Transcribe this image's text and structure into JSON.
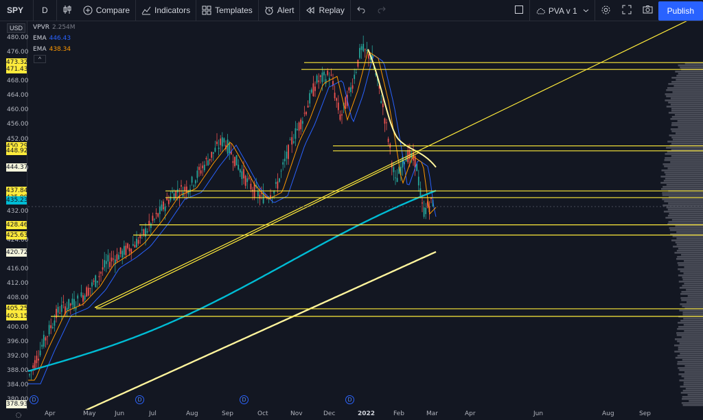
{
  "toolbar": {
    "symbol": "SPY",
    "interval": "D",
    "compare": "Compare",
    "indicators": "Indicators",
    "templates": "Templates",
    "alert": "Alert",
    "replay": "Replay",
    "layout": "PVA v 1",
    "publish": "Publish"
  },
  "currency": "USD",
  "legend": {
    "vpvr_name": "VPVR",
    "vpvr_value": "2.254M",
    "ema1_name": "EMA",
    "ema1_value": "446.43",
    "ema1_color": "#2962ff",
    "ema2_name": "EMA",
    "ema2_value": "438.34",
    "ema2_color": "#ff9800",
    "collapse": "^"
  },
  "price_ticks": [
    "480.00",
    "476.00",
    "468.00",
    "464.00",
    "460.00",
    "456.00",
    "452.00",
    "444.00",
    "432.00",
    "424.00",
    "416.00",
    "412.00",
    "408.00",
    "400.00",
    "396.00",
    "392.00",
    "388.00",
    "384.00",
    "380.00"
  ],
  "price_tags": [
    {
      "label": "473.32",
      "style": "yellow"
    },
    {
      "label": "471.43",
      "style": "yellow"
    },
    {
      "label": "450.29",
      "style": "yellow"
    },
    {
      "label": "448.92",
      "style": "yellow"
    },
    {
      "label": "444.37",
      "style": "white"
    },
    {
      "label": "437.84",
      "style": "yellow"
    },
    {
      "label": "435.99",
      "style": "yellow"
    },
    {
      "label": "435.23",
      "style": "cyan"
    },
    {
      "label": "428.46",
      "style": "yellow"
    },
    {
      "label": "425.63",
      "style": "yellow"
    },
    {
      "label": "420.72",
      "style": "white"
    },
    {
      "label": "405.25",
      "style": "yellow"
    },
    {
      "label": "403.15",
      "style": "yellow"
    },
    {
      "label": "378.93",
      "style": "white"
    }
  ],
  "time_labels": [
    {
      "label": "Apr",
      "bold": false
    },
    {
      "label": "May",
      "bold": false
    },
    {
      "label": "Jun",
      "bold": false
    },
    {
      "label": "Jul",
      "bold": false
    },
    {
      "label": "Aug",
      "bold": false
    },
    {
      "label": "Sep",
      "bold": false
    },
    {
      "label": "Oct",
      "bold": false
    },
    {
      "label": "Nov",
      "bold": false
    },
    {
      "label": "Dec",
      "bold": false
    },
    {
      "label": "2022",
      "bold": true
    },
    {
      "label": "Feb",
      "bold": false
    },
    {
      "label": "Mar",
      "bold": false
    },
    {
      "label": "Apr",
      "bold": false
    },
    {
      "label": "Jun",
      "bold": false
    },
    {
      "label": "Aug",
      "bold": false
    },
    {
      "label": "Sep",
      "bold": false
    }
  ],
  "dividend_marker": "D",
  "colors": {
    "up": "#26a69a",
    "down": "#ef5350",
    "level": "#ffeb3b",
    "sma200": "#fff59d",
    "ema_cyan": "#00bcd4",
    "bg": "#131722"
  },
  "chart_data": {
    "type": "candlestick",
    "symbol": "SPY",
    "interval": "D",
    "horizontal_levels": [
      473.32,
      471.43,
      450.29,
      448.92,
      437.84,
      435.99,
      428.46,
      425.63,
      405.25,
      403.15
    ],
    "moving_averages": [
      {
        "value": 446.43,
        "color": "#2962ff"
      },
      {
        "value": 438.34,
        "color": "#ff9800"
      },
      {
        "value": 435.23,
        "color": "#00bcd4"
      },
      {
        "value": 444.37,
        "color": "#fff59d"
      },
      {
        "value": 420.72,
        "color": "#fff59d"
      }
    ],
    "ylim": [
      378,
      482
    ],
    "trendlines": 2,
    "volume_profile": "VPVR 2.254M"
  }
}
